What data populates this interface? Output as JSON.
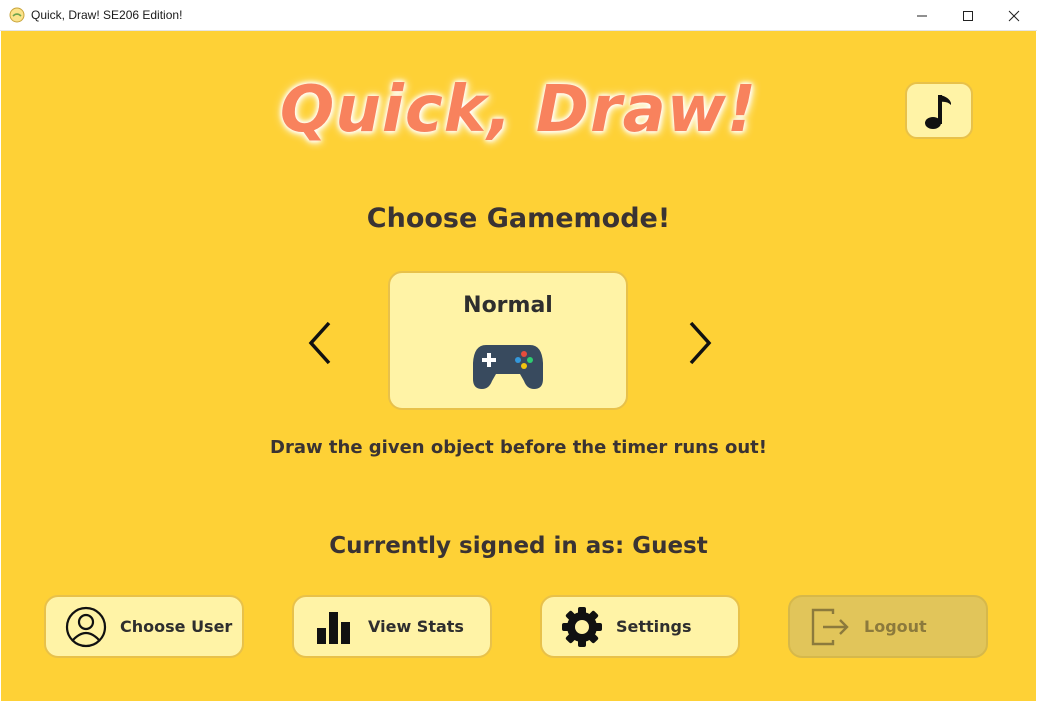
{
  "window": {
    "title": "Quick, Draw! SE206 Edition!"
  },
  "logo": {
    "text": "Quick, Draw!"
  },
  "music": {
    "icon": "music-note-icon"
  },
  "gamemode": {
    "heading": "Choose Gamemode!",
    "selected": "Normal",
    "icon": "gamepad-icon",
    "description": "Draw the given object before the timer runs out!"
  },
  "user": {
    "signed_in_text": "Currently signed in as: Guest"
  },
  "buttons": {
    "choose_user": "Choose User",
    "view_stats": "View Stats",
    "settings": "Settings",
    "logout": "Logout"
  },
  "colors": {
    "background": "#fed136",
    "card": "#fff3a6",
    "logo": "#f8825d",
    "border": "#e8c14a"
  }
}
